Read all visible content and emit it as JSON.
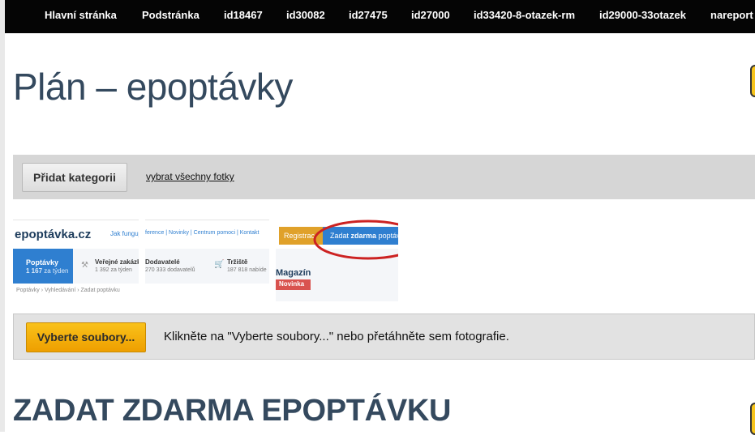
{
  "nav": {
    "items": [
      {
        "label": "Hlavní stránka"
      },
      {
        "label": "Podstránka"
      },
      {
        "label": "id18467"
      },
      {
        "label": "id30082"
      },
      {
        "label": "id27475"
      },
      {
        "label": "id27000"
      },
      {
        "label": "id33420-8-otazek-rm"
      },
      {
        "label": "id29000-33otazek"
      },
      {
        "label": "nareport"
      }
    ]
  },
  "page": {
    "title": "Plán – epoptávky",
    "section_heading": "ZADAT ZDARMA EPOPTÁVKU"
  },
  "categories": {
    "add_button": "Přidat kategorii",
    "select_all_link": "vybrat všechny fotky"
  },
  "thumbnails": {
    "t1": {
      "logo": "epoptávka.cz",
      "howto": "Jak funguje",
      "tab_active_title": "Poptávky",
      "tab_active_count": "1 167",
      "tab_active_suffix": "za týden",
      "tab2_title": "Veřejné zakázky",
      "tab2_count": "1 392",
      "tab2_suffix": "za týden",
      "breadcrumb": "Poptávky  ›  Vyhledávání  ›  Zadat poptávku"
    },
    "t2": {
      "links": "ference  |  Novinky  |  Centrum pomoci  |  Kontakt",
      "tab1_title": "Dodavatelé",
      "tab1_count": "270 333",
      "tab1_suffix": "dodavatelů",
      "tab2_title": "Tržiště",
      "tab2_count": "187 818",
      "tab2_suffix": "nabíde"
    },
    "t3": {
      "register": "Registrac",
      "cta_prefix": "Zadat",
      "cta_bold": "zdarma",
      "cta_suffix": "poptáv",
      "magazine": "Magazín",
      "badge": "Novinka"
    }
  },
  "upload": {
    "button": "Vyberte soubory...",
    "hint": "Klikněte na \"Vyberte soubory...\" nebo přetáhněte sem fotografie."
  },
  "colors": {
    "nav_bg": "#050505",
    "title": "#34495e",
    "upload_button": "#f5b50f",
    "accent_blue": "#2f7fd0",
    "badge_red": "#d9534f"
  }
}
